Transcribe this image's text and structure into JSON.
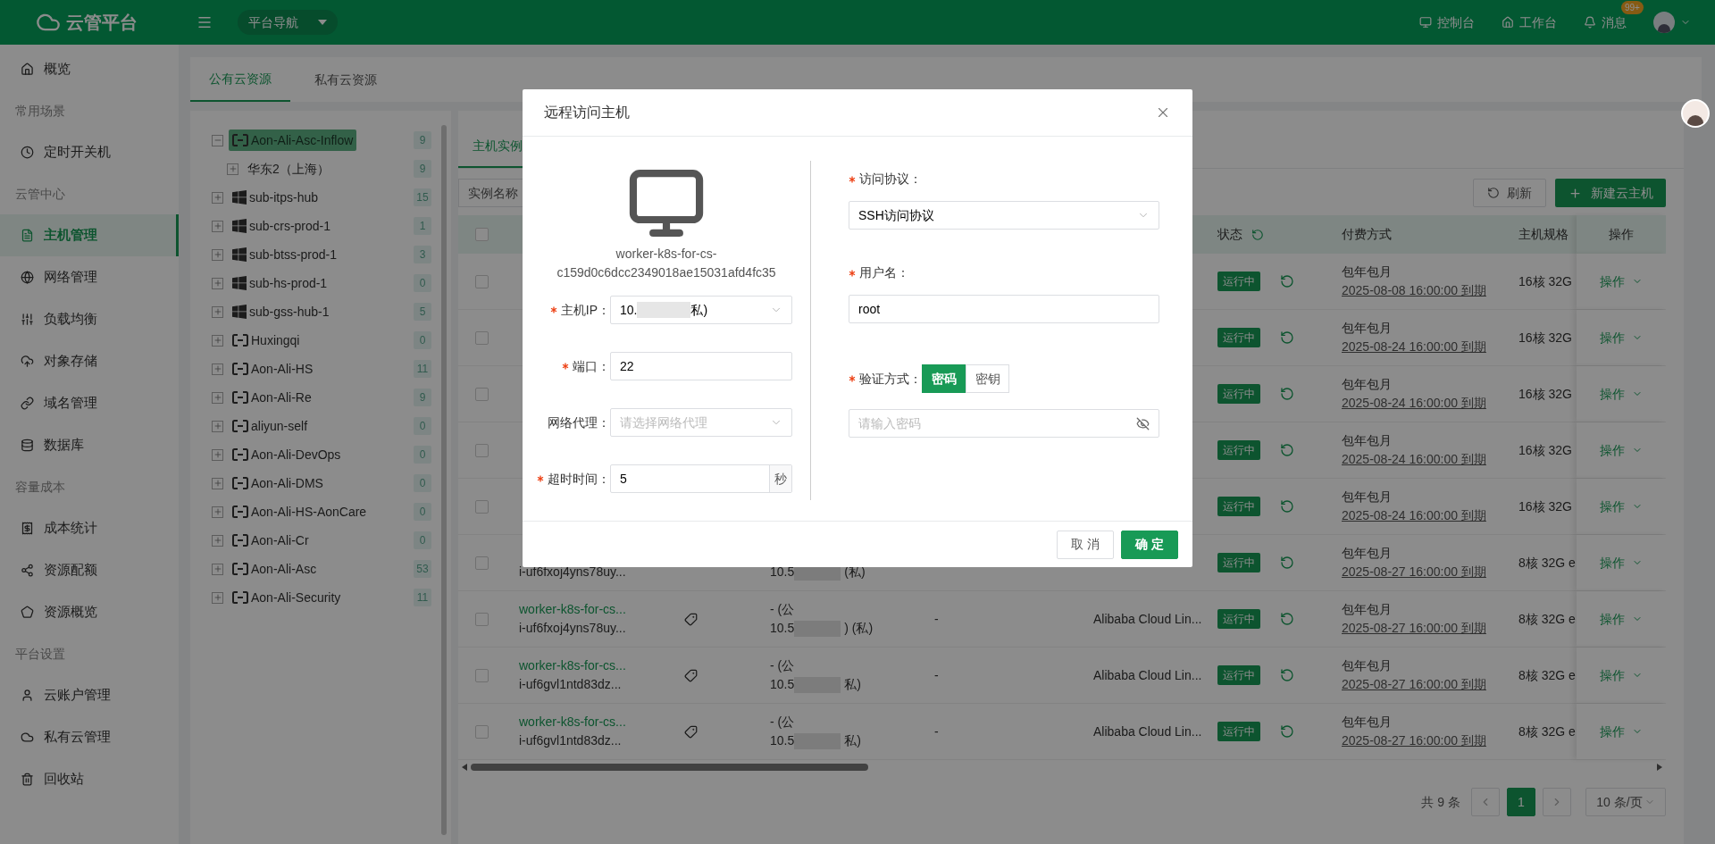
{
  "header": {
    "title": "云管平台",
    "nav_dropdown": "平台导航",
    "links": [
      {
        "label": "控制台"
      },
      {
        "label": "工作台"
      },
      {
        "label": "消息",
        "badge": "99+"
      }
    ]
  },
  "sidebar": {
    "items": [
      {
        "kind": "item",
        "label": "概览",
        "selected": false
      },
      {
        "kind": "section",
        "label": "常用场景"
      },
      {
        "kind": "item",
        "label": "定时开关机",
        "selected": false
      },
      {
        "kind": "section",
        "label": "云管中心"
      },
      {
        "kind": "item",
        "label": "主机管理",
        "selected": true
      },
      {
        "kind": "item",
        "label": "网络管理",
        "selected": false
      },
      {
        "kind": "item",
        "label": "负载均衡",
        "selected": false
      },
      {
        "kind": "item",
        "label": "对象存储",
        "selected": false
      },
      {
        "kind": "item",
        "label": "域名管理",
        "selected": false
      },
      {
        "kind": "item",
        "label": "数据库",
        "selected": false
      },
      {
        "kind": "section",
        "label": "容量成本"
      },
      {
        "kind": "item",
        "label": "成本统计",
        "selected": false
      },
      {
        "kind": "item",
        "label": "资源配额",
        "selected": false
      },
      {
        "kind": "item",
        "label": "资源概览",
        "selected": false
      },
      {
        "kind": "section",
        "label": "平台设置"
      },
      {
        "kind": "item",
        "label": "云账户管理",
        "selected": false
      },
      {
        "kind": "item",
        "label": "私有云管理",
        "selected": false
      },
      {
        "kind": "item",
        "label": "回收站",
        "selected": false
      }
    ]
  },
  "resource_tabs": [
    {
      "label": "公有云资源",
      "selected": true
    },
    {
      "label": "私有云资源",
      "selected": false
    }
  ],
  "tree": [
    {
      "kind": "aliyun",
      "label": "Aon-Ali-Asc-Inflow",
      "count": "9",
      "expanded": true,
      "selected": true,
      "children": [
        {
          "label": "华东2（上海）",
          "count": "9",
          "expanded": false,
          "selected": false
        }
      ]
    },
    {
      "kind": "windows",
      "label": "sub-itps-hub",
      "count": "15",
      "expanded": false,
      "selected": false
    },
    {
      "kind": "windows",
      "label": "sub-crs-prod-1",
      "count": "1",
      "expanded": false,
      "selected": false
    },
    {
      "kind": "windows",
      "label": "sub-btss-prod-1",
      "count": "3",
      "expanded": false,
      "selected": false
    },
    {
      "kind": "windows",
      "label": "sub-hs-prod-1",
      "count": "0",
      "expanded": false,
      "selected": false
    },
    {
      "kind": "windows",
      "label": "sub-gss-hub-1",
      "count": "5",
      "expanded": false,
      "selected": false
    },
    {
      "kind": "aliyun",
      "label": "Huxingqi",
      "count": "0",
      "expanded": false,
      "selected": false
    },
    {
      "kind": "aliyun",
      "label": "Aon-Ali-HS",
      "count": "11",
      "expanded": false,
      "selected": false
    },
    {
      "kind": "aliyun",
      "label": "Aon-Ali-Re",
      "count": "9",
      "expanded": false,
      "selected": false
    },
    {
      "kind": "aliyun",
      "label": "aliyun-self",
      "count": "0",
      "expanded": false,
      "selected": false
    },
    {
      "kind": "aliyun",
      "label": "Aon-Ali-DevOps",
      "count": "0",
      "expanded": false,
      "selected": false
    },
    {
      "kind": "aliyun",
      "label": "Aon-Ali-DMS",
      "count": "0",
      "expanded": false,
      "selected": false
    },
    {
      "kind": "aliyun",
      "label": "Aon-Ali-HS-AonCare",
      "count": "0",
      "expanded": false,
      "selected": false
    },
    {
      "kind": "aliyun",
      "label": "Aon-Ali-Cr",
      "count": "0",
      "expanded": false,
      "selected": false
    },
    {
      "kind": "aliyun",
      "label": "Aon-Ali-Asc",
      "count": "53",
      "expanded": false,
      "selected": false
    },
    {
      "kind": "aliyun",
      "label": "Aon-Ali-Security",
      "count": "11",
      "expanded": false,
      "selected": false
    }
  ],
  "host_tabs": [
    {
      "label": "主机实例",
      "selected": true
    }
  ],
  "filter": {
    "label": "实例名称"
  },
  "toolbar": {
    "refresh": "刷新",
    "create": "新建云主机"
  },
  "table": {
    "header": {
      "checked": false,
      "status": "状态",
      "payment": "付费方式",
      "spec": "主机规格",
      "actions": "操作"
    },
    "rows": [
      {
        "checked": false,
        "status": "运行中",
        "payment": "包年包月",
        "expiry": "2025-08-08 16:00:00 到期",
        "spec": "16核 32G",
        "action": "操作"
      },
      {
        "checked": false,
        "status": "运行中",
        "payment": "包年包月",
        "expiry": "2025-08-24 16:00:00 到期",
        "spec": "16核 32G",
        "action": "操作"
      },
      {
        "checked": false,
        "status": "运行中",
        "payment": "包年包月",
        "expiry": "2025-08-24 16:00:00 到期",
        "spec": "16核 32G",
        "action": "操作"
      },
      {
        "checked": false,
        "status": "运行中",
        "payment": "包年包月",
        "expiry": "2025-08-24 16:00:00 到期",
        "spec": "16核 32G",
        "action": "操作"
      },
      {
        "checked": false,
        "status": "运行中",
        "payment": "包年包月",
        "expiry": "2025-08-24 16:00:00 到期",
        "spec": "16核 32G",
        "action": "操作"
      },
      {
        "checked": false,
        "id": "i-uf6fxoj4yns78uy...",
        "ip_private_start": "10.5",
        "ip_private_end": "(私)",
        "status": "运行中",
        "payment": "包年包月",
        "expiry": "2025-08-27 16:00:00 到期",
        "spec": "8核 32G e",
        "action": "操作"
      },
      {
        "checked": false,
        "name": "worker-k8s-for-cs...",
        "id": "i-uf6fxoj4yns78uy...",
        "ip_public": "- (公",
        "ip_private_start": "10.5",
        "ip_private_end": ") (私)",
        "column_5": "-",
        "os": "Alibaba Cloud Lin...",
        "status": "运行中",
        "payment": "包年包月",
        "expiry": "2025-08-27 16:00:00 到期",
        "spec": "8核 32G e",
        "action": "操作"
      },
      {
        "checked": false,
        "name": "worker-k8s-for-cs...",
        "id": "i-uf6gvl1ntd83dz...",
        "ip_public": "- (公",
        "ip_private_start": "10.5",
        "ip_private_end": "私)",
        "column_5": "-",
        "os": "Alibaba Cloud Lin...",
        "status": "运行中",
        "payment": "包年包月",
        "expiry": "2025-08-27 16:00:00 到期",
        "spec": "8核 32G e",
        "action": "操作"
      },
      {
        "checked": false,
        "name": "worker-k8s-for-cs...",
        "id": "i-uf6gvl1ntd83dz...",
        "ip_public": "- (公",
        "ip_private_start": "10.5",
        "ip_private_end": "私)",
        "column_5": "-",
        "os": "Alibaba Cloud Lin...",
        "status": "运行中",
        "payment": "包年包月",
        "expiry": "2025-08-27 16:00:00 到期",
        "spec": "8核 32G e",
        "action": "操作"
      }
    ]
  },
  "pagination": {
    "total": "共 9 条",
    "pages": [
      {
        "label": "1",
        "selected": true
      }
    ],
    "page_size": "10 条/页"
  },
  "modal": {
    "title": "远程访问主机",
    "host_name": "worker-k8s-for-cs-c159d0c6dcc2349018ae15031afd4fc35",
    "left_fields": [
      {
        "kind": "select",
        "label": "主机IP：",
        "required": true,
        "value_start": "10.",
        "value_end": "私)"
      },
      {
        "kind": "input",
        "label": "端口：",
        "required": true,
        "value": "22"
      },
      {
        "kind": "select",
        "label": "网络代理：",
        "required": false,
        "placeholder": "请选择网络代理"
      },
      {
        "kind": "addon",
        "label": "超时时间：",
        "required": true,
        "value": "5",
        "addon": "秒"
      }
    ],
    "right_fields": [
      {
        "kind": "select",
        "label": "访问协议：",
        "required": true,
        "value": "SSH访问协议"
      },
      {
        "kind": "input",
        "label": "用户名：",
        "required": true,
        "value": "root"
      },
      {
        "kind": "segmented",
        "label": "验证方式：",
        "required": true,
        "options": [
          {
            "label": "密码",
            "selected": true
          },
          {
            "label": "密钥",
            "selected": false
          }
        ]
      },
      {
        "kind": "password",
        "placeholder": "请输入密码"
      }
    ],
    "buttons": [
      {
        "kind": "default",
        "label": "取 消"
      },
      {
        "kind": "primary",
        "label": "确 定"
      }
    ]
  }
}
